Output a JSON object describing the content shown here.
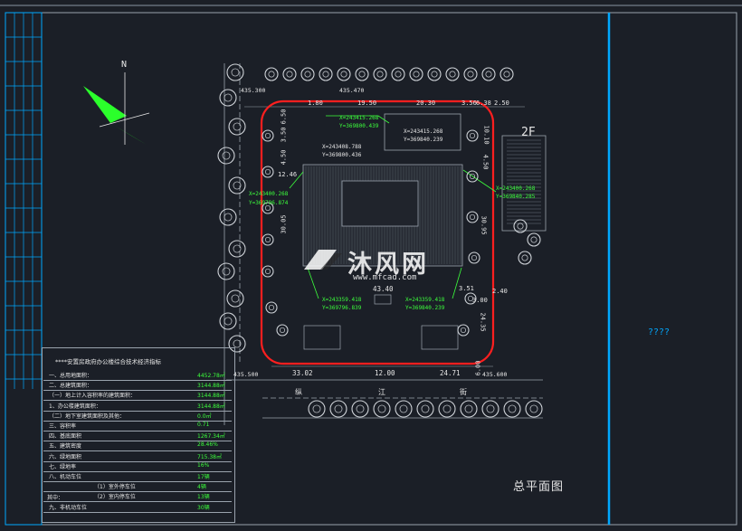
{
  "drawing": {
    "title": "总平面图",
    "right_panel_text": "????",
    "north_label": "N",
    "building_label": "2F",
    "watermark_brand": "沐风网",
    "watermark_url": "www.mfcad.com",
    "road_labels": [
      "纵",
      "江",
      "街"
    ],
    "dimensions": {
      "top": [
        "1.80",
        "19.50",
        "20.30",
        "3.56",
        "6.38",
        "2.50"
      ],
      "left": [
        "3.50",
        "4.50",
        "6.50",
        "12.46",
        "30.05"
      ],
      "right": [
        "10.10",
        "4.50",
        "30.95",
        "2.40",
        "3.51",
        "3.00",
        "24.35"
      ],
      "bottom": [
        "33.02",
        "12.00",
        "24.71",
        "6.00"
      ],
      "inner": "43.40"
    },
    "elevations": [
      "435.300",
      "435.470",
      "435.500",
      "435.600"
    ],
    "coordinates": [
      {
        "x": "X=243415.268",
        "y": "Y=369800.439"
      },
      {
        "x": "X=243415.268",
        "y": "Y=369840.239"
      },
      {
        "x": "X=243408.788",
        "y": "Y=369800.436"
      },
      {
        "x": "X=243400.268",
        "y": "Y=369840.285"
      },
      {
        "x": "X=243400.268",
        "y": "Y=369796.874"
      },
      {
        "x": "X=243359.418",
        "y": "Y=369796.839"
      },
      {
        "x": "X=243359.418",
        "y": "Y=369840.239"
      }
    ]
  },
  "table": {
    "title": "****安置房政府办公楼综合技术经济指标",
    "rows": [
      {
        "label": "一、总用地面积：",
        "value": "4452.78㎡"
      },
      {
        "label": "二、总建筑面积：",
        "value": "3144.88㎡"
      },
      {
        "label": "（一）地上计入容积率的建筑面积：",
        "value": "3144.88㎡"
      },
      {
        "label": "1、办公楼建筑面积：",
        "value": "3144.88㎡"
      },
      {
        "label": "（二）地下室建筑面积及其他：",
        "value": "0.0㎡"
      },
      {
        "label": "三、容积率",
        "value": "0.71"
      },
      {
        "label": "四、基底面积",
        "value": "1267.34㎡"
      },
      {
        "label": "五、建筑密度",
        "value": "28.46%"
      },
      {
        "label": "六、绿地面积",
        "value": "715.38㎡"
      },
      {
        "label": "七、绿地率",
        "value": "16%"
      },
      {
        "label": "八、机动车位",
        "value": "17辆"
      },
      {
        "label": "（1）室外停车位",
        "value": "4辆"
      },
      {
        "label": "（2）室内停车位",
        "value": "13辆"
      },
      {
        "label": "九、非机动车位",
        "value": "30辆"
      }
    ],
    "side_label": "其中："
  },
  "colors": {
    "background": "#1b1f27",
    "frame": "#00a8ff",
    "redline": "#ff1f1f",
    "green": "#3cff3c",
    "white": "#e6e6e6",
    "tree": "#cfd3d8"
  }
}
